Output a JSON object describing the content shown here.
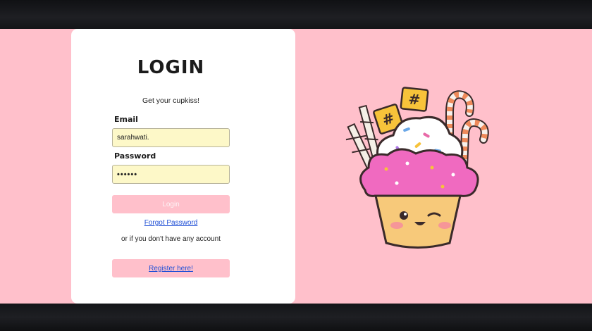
{
  "login": {
    "title": "LOGIN",
    "subtitle": "Get your cupkiss!",
    "email_label": "Email",
    "email_value": "sarahwati.",
    "password_label": "Password",
    "password_value": "••••••",
    "login_button": "Login",
    "forgot_link": "Forgot Password",
    "or_text": "or if you don't have any account",
    "register_link": "Register here!"
  },
  "colors": {
    "background_pink": "#ffc0cb",
    "card": "#ffffff",
    "input_fill": "#fdf8c8",
    "link": "#1f4fd6"
  },
  "illustration": {
    "icon": "cupcake-illustration"
  }
}
